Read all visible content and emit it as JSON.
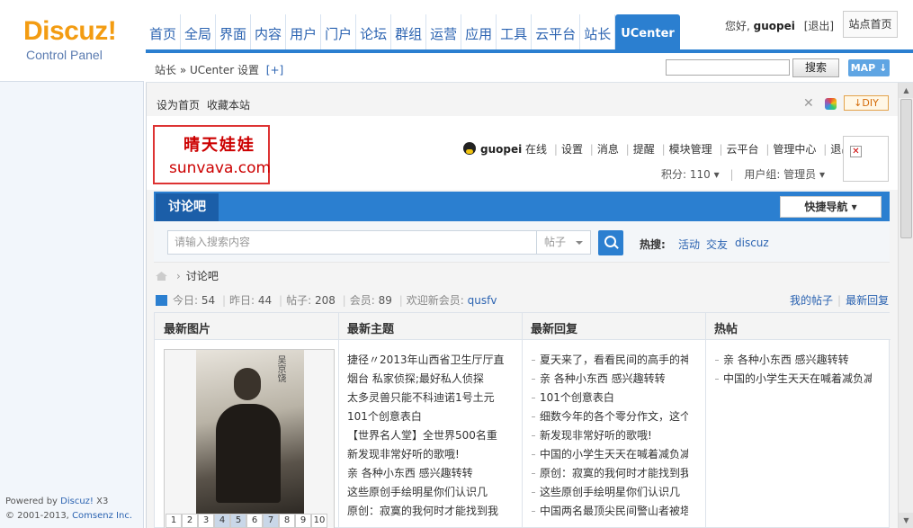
{
  "brand": {
    "logo": "Discuz!",
    "subtitle": "Control Panel"
  },
  "topnav": [
    "首页",
    "全局",
    "界面",
    "内容",
    "用户",
    "门户",
    "论坛",
    "群组",
    "运营",
    "应用",
    "工具",
    "云平台",
    "站长",
    "UCenter"
  ],
  "topnav_active": "UCenter",
  "user": {
    "greeting": "您好,",
    "name": "guopei",
    "logout": "[退出]",
    "site_home": "站点首页"
  },
  "subbar": {
    "breadcrumb": "站长 » UCenter 设置",
    "add": "[+]",
    "search_value": "",
    "search_button": "搜索",
    "map_button": "MAP"
  },
  "footer": {
    "powered_prefix": "Powered by",
    "powered_link": "Discuz!",
    "version": "X3",
    "copyright": "© 2001-2013,",
    "company": "Comsenz Inc."
  },
  "forum": {
    "top_links": {
      "set_home": "设为首页",
      "favorite": "收藏本站",
      "diy": "DIY"
    },
    "logo": {
      "cn": "晴天娃娃",
      "en": "sunvava.com"
    },
    "user_bar": {
      "name": "guopei",
      "status": "在线",
      "links": [
        "设置",
        "消息",
        "提醒",
        "模块管理",
        "云平台",
        "管理中心",
        "退出"
      ]
    },
    "user_bar2": {
      "credits": "积分: 110",
      "group": "用户组: 管理员"
    },
    "nav_tab": "讨论吧",
    "quick_nav": "快捷导航",
    "search": {
      "placeholder": "请输入搜索内容",
      "type": "帖子",
      "hot_label": "热搜:",
      "hot": [
        "活动",
        "交友",
        "discuz"
      ]
    },
    "crumb": "讨论吧",
    "stats": {
      "today_label": "今日:",
      "today": "54",
      "yesterday_label": "昨日:",
      "yesterday": "44",
      "posts_label": "帖子:",
      "posts": "208",
      "members_label": "会员:",
      "members": "89",
      "welcome": "欢迎新会员:",
      "new_member": "qusfv"
    },
    "my_links": [
      "我的帖子",
      "最新回复"
    ],
    "columns": {
      "titles": [
        "最新图片",
        "最新主题",
        "最新回复",
        "热帖"
      ],
      "pager": [
        "1",
        "2",
        "3",
        "4",
        "5",
        "6",
        "7",
        "8",
        "9",
        "10"
      ],
      "pic_sig": "吴京饶",
      "new_topics": [
        "捷径〃2013年山西省卫生厅厅直",
        "烟台   私家侦探;最好私人侦探",
        "太多灵兽只能不科迪诺1号土元",
        "101个创意表白",
        "【世界名人堂】全世界500名重",
        "新发现非常好听的歌哦!",
        "亲 各种小东西 感兴趣转转",
        "这些原创手绘明星你们认识几",
        "原创：寂寞的我何时才能找到我"
      ],
      "new_replies": [
        "夏天来了，看看民间的高手的神",
        "亲 各种小东西 感兴趣转转",
        "101个创意表白",
        "细数今年的各个零分作文，这个",
        "新发现非常好听的歌哦!",
        "中国的小学生天天在喊着减负减",
        "原创：寂寞的我何时才能找到我",
        "这些原创手绘明星你们认识几",
        "中国两名最顶尖民间警山者被塔"
      ],
      "hot": [
        "亲 各种小东西 感兴趣转转",
        "中国的小学生天天在喊着减负减"
      ]
    }
  }
}
